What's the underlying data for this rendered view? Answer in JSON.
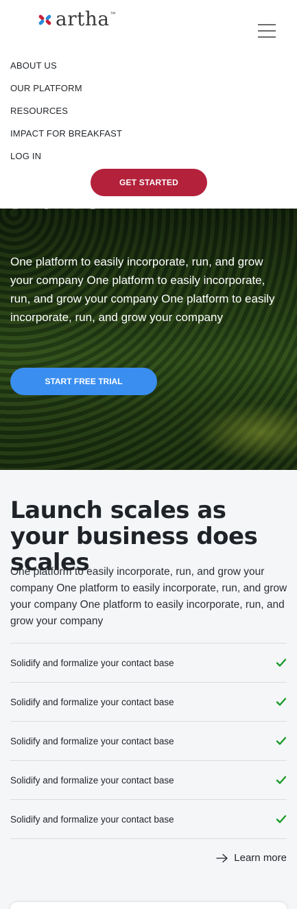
{
  "header": {
    "logo_text": "artha",
    "logo_tm": "™",
    "nav": [
      {
        "label": "ABOUT US"
      },
      {
        "label": "OUR PLATFORM"
      },
      {
        "label": "RESOURCES"
      },
      {
        "label": "IMPACT FOR BREAKFAST"
      },
      {
        "label": "LOG IN"
      }
    ],
    "cta_label": "GET STARTED"
  },
  "hero": {
    "title_fragment": "Platform",
    "text": "One platform to easily incorporate, run, and grow your company One platform to easily incorporate, run, and grow your company One platform to easily incorporate, run, and grow your company",
    "cta_label": "START FREE TRIAL"
  },
  "section": {
    "title": "Launch scales as your business does scales",
    "text": "One platform to easily incorporate, run, and grow your company One platform to easily incorporate, run, and grow your company One platform to easily incorporate, run, and grow your company",
    "features": [
      {
        "label": "Solidify and formalize your contact base"
      },
      {
        "label": "Solidify and formalize your contact base"
      },
      {
        "label": "Solidify and formalize your contact base"
      },
      {
        "label": "Solidify and formalize your contact base"
      },
      {
        "label": "Solidify and formalize your contact base"
      }
    ],
    "learn_more_label": "Learn more"
  },
  "colors": {
    "brand_red": "#b3213b",
    "accent_blue": "#3a8ef0",
    "check_green": "#1a9a2a"
  },
  "icons": {
    "menu": "hamburger-menu-icon",
    "check": "check-icon",
    "arrow": "arrow-right-icon"
  }
}
